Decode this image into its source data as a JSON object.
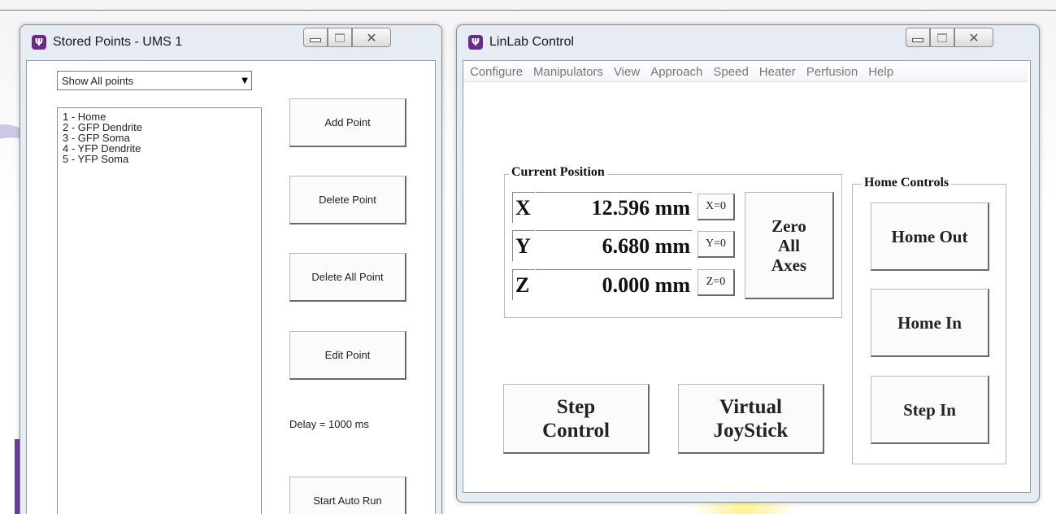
{
  "stored_points_window": {
    "title": "Stored Points - UMS 1",
    "filter_dropdown": {
      "value": "Show All points"
    },
    "points": [
      "1 - Home",
      "2 - GFP Dendrite",
      "3 - GFP Soma",
      "4 - YFP Dendrite",
      "5 - YFP Soma"
    ],
    "buttons": {
      "add": "Add Point",
      "delete": "Delete Point",
      "delete_all": "Delete All Point",
      "edit": "Edit Point",
      "start_auto_run": "Start Auto Run"
    },
    "delay_label": "Delay = 1000 ms"
  },
  "linlab_window": {
    "title": "LinLab Control",
    "menu": [
      "Configure",
      "Manipulators",
      "View",
      "Approach",
      "Speed",
      "Heater",
      "Perfusion",
      "Help"
    ],
    "current_position": {
      "legend": "Current Position",
      "axes": [
        {
          "letter": "X",
          "value": "12.596 mm",
          "zero_label": "X=0"
        },
        {
          "letter": "Y",
          "value": "6.680 mm",
          "zero_label": "Y=0"
        },
        {
          "letter": "Z",
          "value": "0.000 mm",
          "zero_label": "Z=0"
        }
      ],
      "zero_all": {
        "line1": "Zero",
        "line2": "All",
        "line3": "Axes"
      }
    },
    "step_control": {
      "line1": "Step",
      "line2": "Control"
    },
    "virtual_joystick": {
      "line1": "Virtual",
      "line2": "JoyStick"
    },
    "home_controls": {
      "legend": "Home Controls",
      "home_out": "Home Out",
      "home_in": "Home In",
      "step_in": "Step In"
    }
  },
  "icons": [
    "app-icon",
    "minimize-icon",
    "maximize-icon",
    "close-icon",
    "chevron-down-icon"
  ],
  "colors": {
    "app_icon": "#6b2a8e",
    "frame": "#e6ecf3",
    "deco_accent": "#6a3fa3"
  }
}
